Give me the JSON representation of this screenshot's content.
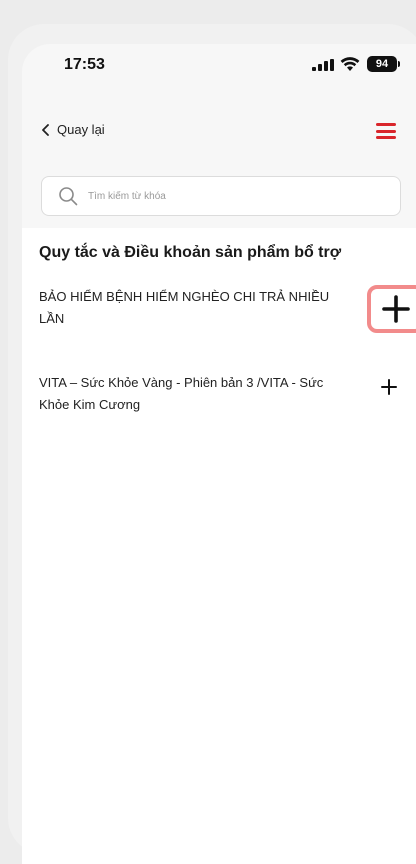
{
  "status_bar": {
    "time": "17:53",
    "battery": "94"
  },
  "nav": {
    "back_label": "Quay lại"
  },
  "search": {
    "placeholder": "Tìm kiếm từ khóa"
  },
  "section": {
    "title": "Quy tắc và Điều khoản sản phẩm bổ trợ",
    "items": [
      {
        "label": "BẢO HIỂM BỆNH HIỂM NGHÈO CHI TRẢ NHIỀU LẦN"
      },
      {
        "label": "VITA – Sức Khỏe Vàng - Phiên bản 3 /VITA - Sức Khỏe Kim Cương"
      }
    ]
  },
  "colors": {
    "accent": "#d9262b",
    "highlight": "#f28b8b"
  },
  "icons": [
    "chevron-left-icon",
    "hamburger-menu-icon",
    "search-icon",
    "plus-icon",
    "signal-icon",
    "wifi-icon",
    "battery-icon"
  ]
}
